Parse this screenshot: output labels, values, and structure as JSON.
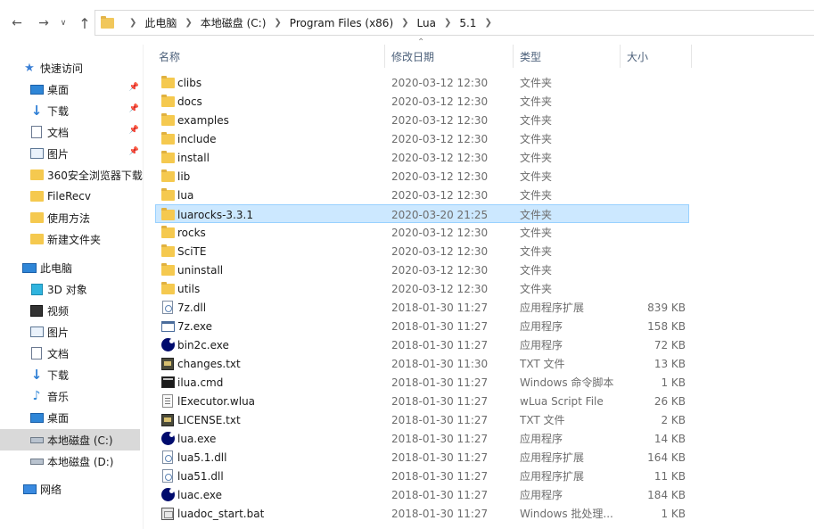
{
  "address": {
    "crumbs": [
      "此电脑",
      "本地磁盘 (C:)",
      "Program Files (x86)",
      "Lua",
      "5.1"
    ]
  },
  "sidebar": {
    "items": [
      {
        "label": "快速访问",
        "icon": "star-icon",
        "level": 0,
        "pinned": false
      },
      {
        "label": "桌面",
        "icon": "desktop-icon",
        "level": 1,
        "pinned": true
      },
      {
        "label": "下载",
        "icon": "download-icon",
        "level": 1,
        "pinned": true
      },
      {
        "label": "文档",
        "icon": "documents-icon",
        "level": 1,
        "pinned": true
      },
      {
        "label": "图片",
        "icon": "pictures-icon",
        "level": 1,
        "pinned": true
      },
      {
        "label": "360安全浏览器下载",
        "icon": "folder-icon",
        "level": 1,
        "pinned": false
      },
      {
        "label": "FileRecv",
        "icon": "folder-icon",
        "level": 1,
        "pinned": false
      },
      {
        "label": "使用方法",
        "icon": "folder-icon",
        "level": 1,
        "pinned": false
      },
      {
        "label": "新建文件夹",
        "icon": "folder-icon",
        "level": 1,
        "pinned": false
      },
      {
        "label": "此电脑",
        "icon": "computer-icon",
        "level": 0,
        "pinned": false
      },
      {
        "label": "3D 对象",
        "icon": "3d-objects-icon",
        "level": 1,
        "pinned": false
      },
      {
        "label": "视频",
        "icon": "videos-icon",
        "level": 1,
        "pinned": false
      },
      {
        "label": "图片",
        "icon": "pictures-icon",
        "level": 1,
        "pinned": false
      },
      {
        "label": "文档",
        "icon": "documents-icon",
        "level": 1,
        "pinned": false
      },
      {
        "label": "下载",
        "icon": "download-icon",
        "level": 1,
        "pinned": false
      },
      {
        "label": "音乐",
        "icon": "music-icon",
        "level": 1,
        "pinned": false
      },
      {
        "label": "桌面",
        "icon": "desktop-icon",
        "level": 1,
        "pinned": false
      },
      {
        "label": "本地磁盘 (C:)",
        "icon": "drive-icon",
        "level": 1,
        "pinned": false,
        "selected": true
      },
      {
        "label": "本地磁盘 (D:)",
        "icon": "drive-icon",
        "level": 1,
        "pinned": false
      },
      {
        "label": "网络",
        "icon": "network-icon",
        "level": 0,
        "pinned": false
      }
    ]
  },
  "columns": {
    "name": "名称",
    "date": "修改日期",
    "type": "类型",
    "size": "大小"
  },
  "files": [
    {
      "name": "clibs",
      "date": "2020-03-12 12:30",
      "type": "文件夹",
      "size": "",
      "icon": "folder-icon"
    },
    {
      "name": "docs",
      "date": "2020-03-12 12:30",
      "type": "文件夹",
      "size": "",
      "icon": "folder-icon"
    },
    {
      "name": "examples",
      "date": "2020-03-12 12:30",
      "type": "文件夹",
      "size": "",
      "icon": "folder-icon"
    },
    {
      "name": "include",
      "date": "2020-03-12 12:30",
      "type": "文件夹",
      "size": "",
      "icon": "folder-icon"
    },
    {
      "name": "install",
      "date": "2020-03-12 12:30",
      "type": "文件夹",
      "size": "",
      "icon": "folder-icon"
    },
    {
      "name": "lib",
      "date": "2020-03-12 12:30",
      "type": "文件夹",
      "size": "",
      "icon": "folder-icon"
    },
    {
      "name": "lua",
      "date": "2020-03-12 12:30",
      "type": "文件夹",
      "size": "",
      "icon": "folder-icon"
    },
    {
      "name": "luarocks-3.3.1",
      "date": "2020-03-20 21:25",
      "type": "文件夹",
      "size": "",
      "icon": "folder-icon",
      "selected": true
    },
    {
      "name": "rocks",
      "date": "2020-03-12 12:30",
      "type": "文件夹",
      "size": "",
      "icon": "folder-icon"
    },
    {
      "name": "SciTE",
      "date": "2020-03-12 12:30",
      "type": "文件夹",
      "size": "",
      "icon": "folder-icon"
    },
    {
      "name": "uninstall",
      "date": "2020-03-12 12:30",
      "type": "文件夹",
      "size": "",
      "icon": "folder-icon"
    },
    {
      "name": "utils",
      "date": "2020-03-12 12:30",
      "type": "文件夹",
      "size": "",
      "icon": "folder-icon"
    },
    {
      "name": "7z.dll",
      "date": "2018-01-30 11:27",
      "type": "应用程序扩展",
      "size": "839 KB",
      "icon": "dll-icon"
    },
    {
      "name": "7z.exe",
      "date": "2018-01-30 11:27",
      "type": "应用程序",
      "size": "158 KB",
      "icon": "exe-icon"
    },
    {
      "name": "bin2c.exe",
      "date": "2018-01-30 11:27",
      "type": "应用程序",
      "size": "72 KB",
      "icon": "lua-icon"
    },
    {
      "name": "changes.txt",
      "date": "2018-01-30 11:30",
      "type": "TXT 文件",
      "size": "13 KB",
      "icon": "txt-icon"
    },
    {
      "name": "ilua.cmd",
      "date": "2018-01-30 11:27",
      "type": "Windows 命令脚本",
      "size": "1 KB",
      "icon": "cmd-icon"
    },
    {
      "name": "lExecutor.wlua",
      "date": "2018-01-30 11:27",
      "type": "wLua Script File",
      "size": "26 KB",
      "icon": "script-icon"
    },
    {
      "name": "LICENSE.txt",
      "date": "2018-01-30 11:27",
      "type": "TXT 文件",
      "size": "2 KB",
      "icon": "txt-icon"
    },
    {
      "name": "lua.exe",
      "date": "2018-01-30 11:27",
      "type": "应用程序",
      "size": "14 KB",
      "icon": "lua-icon"
    },
    {
      "name": "lua5.1.dll",
      "date": "2018-01-30 11:27",
      "type": "应用程序扩展",
      "size": "164 KB",
      "icon": "dll-icon"
    },
    {
      "name": "lua51.dll",
      "date": "2018-01-30 11:27",
      "type": "应用程序扩展",
      "size": "11 KB",
      "icon": "dll-icon"
    },
    {
      "name": "luac.exe",
      "date": "2018-01-30 11:27",
      "type": "应用程序",
      "size": "184 KB",
      "icon": "lua-icon"
    },
    {
      "name": "luadoc_start.bat",
      "date": "2018-01-30 11:27",
      "type": "Windows 批处理...",
      "size": "1 KB",
      "icon": "bat-icon"
    }
  ]
}
